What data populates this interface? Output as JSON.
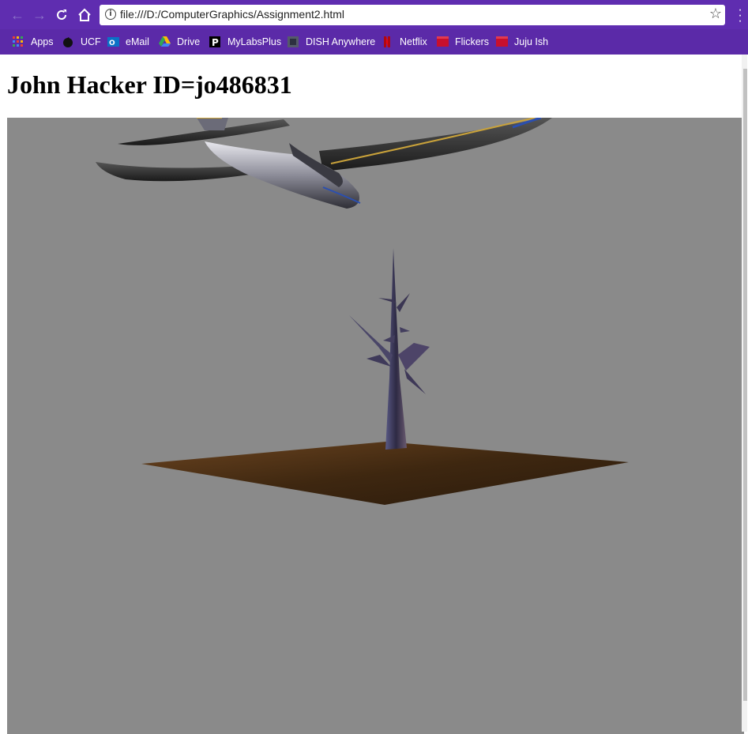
{
  "browser": {
    "url": "file:///D:/ComputerGraphics/Assignment2.html",
    "bookmarks": [
      {
        "label": "Apps",
        "icon": "apps-grid-icon"
      },
      {
        "label": "UCF",
        "icon": "ucf-pegasus-icon"
      },
      {
        "label": "eMail",
        "icon": "outlook-icon"
      },
      {
        "label": "Drive",
        "icon": "google-drive-icon"
      },
      {
        "label": "MyLabsPlus",
        "icon": "mylabsplus-icon"
      },
      {
        "label": "DISH Anywhere",
        "icon": "dish-icon"
      },
      {
        "label": "Netflix",
        "icon": "netflix-icon"
      },
      {
        "label": "Flickers",
        "icon": "flickers-icon"
      },
      {
        "label": "Juju Ish",
        "icon": "juju-icon"
      }
    ],
    "colors": {
      "frame": "#5b2aa8"
    }
  },
  "page": {
    "heading": "John Hacker ID=jo486831"
  },
  "scene": {
    "background": "#8a8a8a",
    "objects": [
      "airplane",
      "bare-tree",
      "dirt-ground-plane"
    ]
  }
}
